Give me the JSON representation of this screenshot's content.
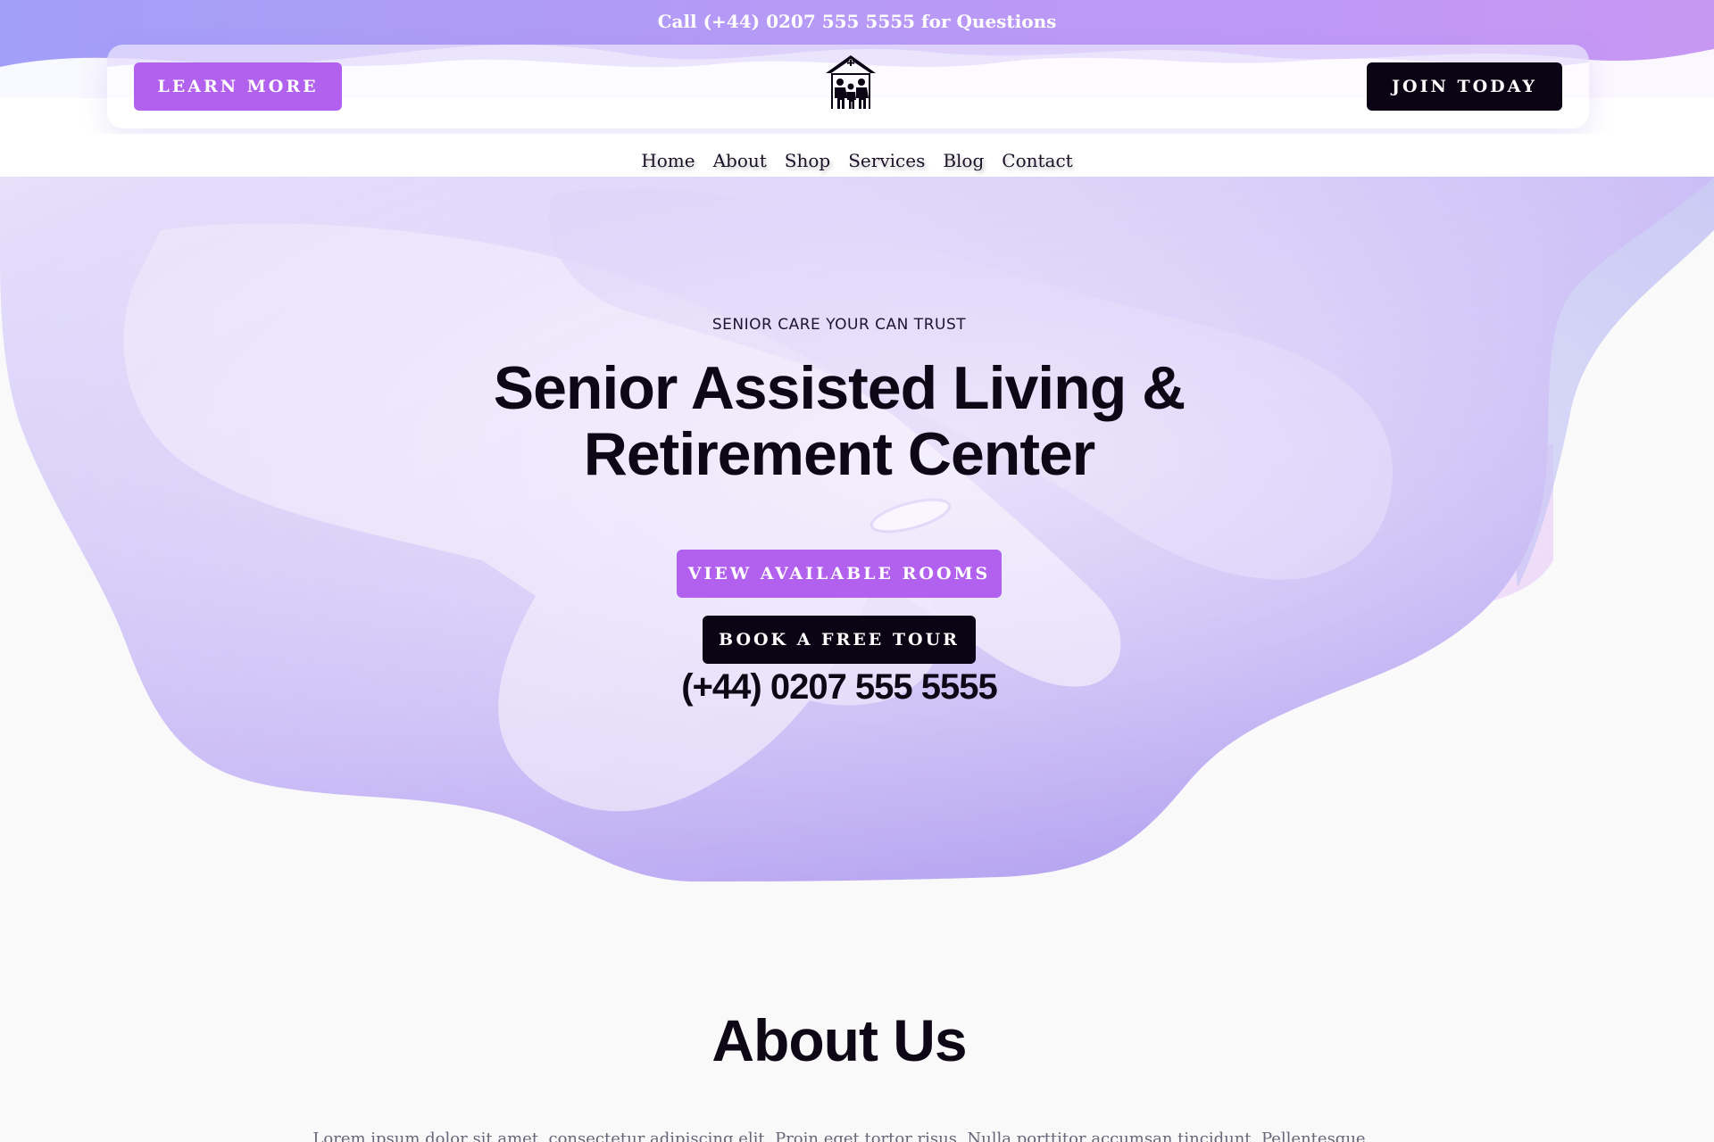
{
  "topbar": {
    "call_text": "Call (+44) 0207 555 5555 for Questions"
  },
  "header": {
    "learn_more_label": "LEARN MORE",
    "join_today_label": "JOIN TODAY",
    "logo_icon": "house-family-icon"
  },
  "nav": {
    "items": [
      {
        "label": "Home"
      },
      {
        "label": "About"
      },
      {
        "label": "Shop"
      },
      {
        "label": "Services"
      },
      {
        "label": "Blog"
      },
      {
        "label": "Contact"
      }
    ]
  },
  "hero": {
    "subtitle": "SENIOR CARE YOUR CAN TRUST",
    "title_line1": "Senior Assisted Living &",
    "title_line2": "Retirement Center",
    "rooms_button": "VIEW AVAILABLE ROOMS",
    "tour_button": "BOOK A FREE TOUR",
    "phone": "(+44) 0207 555 5555"
  },
  "about": {
    "title": "About Us",
    "text": "Lorem ipsum dolor sit amet, consectetur adipiscing elit. Proin eget tortor risus. Nulla porttitor accumsan tincidunt. Pellentesque"
  },
  "colors": {
    "accent_purple": "#b261ee",
    "dark": "#0b0414",
    "gradient_start": "#a29ff8",
    "gradient_end": "#c897f4"
  }
}
